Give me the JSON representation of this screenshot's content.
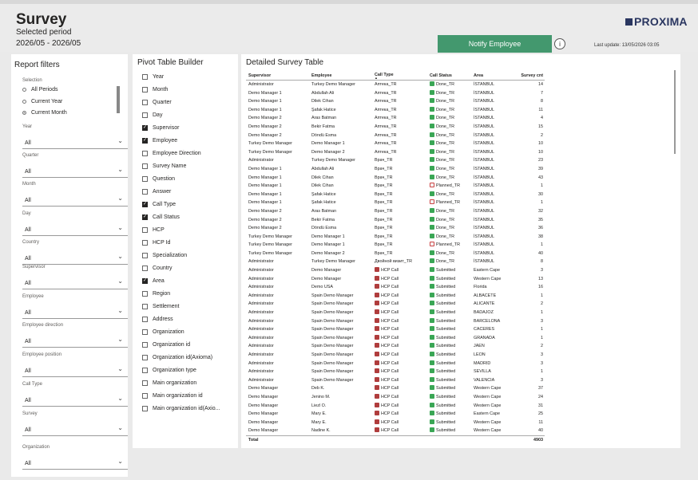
{
  "header": {
    "title": "Survey",
    "subtitle": "Selected period",
    "period": "2026/05 - 2026/05",
    "logo": "PROXIMA",
    "notify_label": "Notify Employee",
    "info_icon": "i",
    "last_update": "Last update: 13/05/2026 03:05"
  },
  "filters": {
    "title": "Report filters",
    "selection_label": "Selection",
    "radios": [
      {
        "label": "All Periods",
        "checked": false
      },
      {
        "label": "Current Year",
        "checked": false
      },
      {
        "label": "Current Month",
        "checked": true
      }
    ],
    "dropdowns": [
      {
        "label": "Year",
        "value": "All"
      },
      {
        "label": "Quarter",
        "value": "All"
      },
      {
        "label": "Month",
        "value": "All"
      },
      {
        "label": "Day",
        "value": "All"
      },
      {
        "label": "Country",
        "value": "All"
      },
      {
        "label": "Supervisor",
        "value": "All"
      },
      {
        "label": "Employee",
        "value": "All"
      },
      {
        "label": "Employee direction",
        "value": "All"
      },
      {
        "label": "Employee position",
        "value": "All"
      },
      {
        "label": "Call Type",
        "value": "All"
      },
      {
        "label": "Survey",
        "value": "All"
      },
      {
        "label": "Organization",
        "value": "All"
      }
    ]
  },
  "pivot": {
    "title": "Pivot Table Builder",
    "items": [
      {
        "label": "Year",
        "checked": false
      },
      {
        "label": "Month",
        "checked": false
      },
      {
        "label": "Quarter",
        "checked": false
      },
      {
        "label": "Day",
        "checked": false
      },
      {
        "label": "Supervisor",
        "checked": true
      },
      {
        "label": "Employee",
        "checked": true
      },
      {
        "label": "Employee Direction",
        "checked": false
      },
      {
        "label": "Survey Name",
        "checked": false
      },
      {
        "label": "Question",
        "checked": false
      },
      {
        "label": "Answer",
        "checked": false
      },
      {
        "label": "Call Type",
        "checked": true
      },
      {
        "label": "Call Status",
        "checked": true
      },
      {
        "label": "HCP",
        "checked": false
      },
      {
        "label": "HCP Id",
        "checked": false
      },
      {
        "label": "Specialization",
        "checked": false
      },
      {
        "label": "Country",
        "checked": false
      },
      {
        "label": "Area",
        "checked": true
      },
      {
        "label": "Region",
        "checked": false
      },
      {
        "label": "Settlement",
        "checked": false
      },
      {
        "label": "Address",
        "checked": false
      },
      {
        "label": "Organization",
        "checked": false
      },
      {
        "label": "Organization id",
        "checked": false
      },
      {
        "label": "Organization id(Axioma)",
        "checked": false
      },
      {
        "label": "Organization type",
        "checked": false
      },
      {
        "label": "Main organization",
        "checked": false
      },
      {
        "label": "Main organization id",
        "checked": false
      },
      {
        "label": "Main organization id(Axio...",
        "checked": false
      }
    ]
  },
  "table": {
    "title": "Detailed Survey Table",
    "columns": [
      "Supervisor",
      "Employee",
      "Call Type",
      "Call Status",
      "Area",
      "Survey cnt"
    ],
    "rows": [
      [
        "Administrator",
        "Turkey Demo Manager",
        "Аптека_TR",
        "Done_TR",
        "İSTANBUL",
        "14"
      ],
      [
        "Demo Manager 1",
        "Abdullah Ali",
        "Аптека_TR",
        "Done_TR",
        "İSTANBUL",
        "7"
      ],
      [
        "Demo Manager 1",
        "Dilek  Cihan",
        "Аптека_TR",
        "Done_TR",
        "İSTANBUL",
        "8"
      ],
      [
        "Demo Manager 1",
        "Şafak Hatice",
        "Аптека_TR",
        "Done_TR",
        "İSTANBUL",
        "11"
      ],
      [
        "Demo Manager 2",
        "Aras Batman",
        "Аптека_TR",
        "Done_TR",
        "İSTANBUL",
        "4"
      ],
      [
        "Demo Manager 2",
        "Bekir Fatma",
        "Аптека_TR",
        "Done_TR",
        "İSTANBUL",
        "15"
      ],
      [
        "Demo Manager 2",
        "Döndü Esma",
        "Аптека_TR",
        "Done_TR",
        "İSTANBUL",
        "2"
      ],
      [
        "Turkey Demo Manager",
        "Demo Manager 1",
        "Аптека_TR",
        "Done_TR",
        "İSTANBUL",
        "10"
      ],
      [
        "Turkey Demo Manager",
        "Demo Manager 2",
        "Аптека_TR",
        "Done_TR",
        "İSTANBUL",
        "10"
      ],
      [
        "Administrator",
        "Turkey Demo Manager",
        "Врач_TR",
        "Done_TR",
        "İSTANBUL",
        "23"
      ],
      [
        "Demo Manager 1",
        "Abdullah Ali",
        "Врач_TR",
        "Done_TR",
        "İSTANBUL",
        "39"
      ],
      [
        "Demo Manager 1",
        "Dilek  Cihan",
        "Врач_TR",
        "Done_TR",
        "İSTANBUL",
        "43"
      ],
      [
        "Demo Manager 1",
        "Dilek  Cihan",
        "Врач_TR",
        "Planned_TR",
        "İSTANBUL",
        "1"
      ],
      [
        "Demo Manager 1",
        "Şafak Hatice",
        "Врач_TR",
        "Done_TR",
        "İSTANBUL",
        "30"
      ],
      [
        "Demo Manager 1",
        "Şafak Hatice",
        "Врач_TR",
        "Planned_TR",
        "İSTANBUL",
        "1"
      ],
      [
        "Demo Manager 2",
        "Aras Batman",
        "Врач_TR",
        "Done_TR",
        "İSTANBUL",
        "32"
      ],
      [
        "Demo Manager 2",
        "Bekir Fatma",
        "Врач_TR",
        "Done_TR",
        "İSTANBUL",
        "35"
      ],
      [
        "Demo Manager 2",
        "Döndü Esma",
        "Врач_TR",
        "Done_TR",
        "İSTANBUL",
        "36"
      ],
      [
        "Turkey Demo Manager",
        "Demo Manager 1",
        "Врач_TR",
        "Done_TR",
        "İSTANBUL",
        "38"
      ],
      [
        "Turkey Demo Manager",
        "Demo Manager 1",
        "Врач_TR",
        "Planned_TR",
        "İSTANBUL",
        "1"
      ],
      [
        "Turkey Demo Manager",
        "Demo Manager 2",
        "Врач_TR",
        "Done_TR",
        "İSTANBUL",
        "40"
      ],
      [
        "Administrator",
        "Turkey Demo Manager",
        "Двойной визит_TR",
        "Done_TR",
        "İSTANBUL",
        "8"
      ],
      [
        "Administrator",
        "Demo Manager",
        "HCP Call",
        "Submitted",
        "Eastern Cape",
        "3"
      ],
      [
        "Administrator",
        "Demo Manager",
        "HCP Call",
        "Submitted",
        "Western Cape",
        "13"
      ],
      [
        "Administrator",
        "Demo USA",
        "HCP Call",
        "Submitted",
        "Florida",
        "16"
      ],
      [
        "Administrator",
        "Spain Demo Manager",
        "HCP Call",
        "Submitted",
        "ALBACETE",
        "1"
      ],
      [
        "Administrator",
        "Spain Demo Manager",
        "HCP Call",
        "Submitted",
        "ALICANTE",
        "2"
      ],
      [
        "Administrator",
        "Spain Demo Manager",
        "HCP Call",
        "Submitted",
        "BADAJOZ",
        "1"
      ],
      [
        "Administrator",
        "Spain Demo Manager",
        "HCP Call",
        "Submitted",
        "BARCELONA",
        "3"
      ],
      [
        "Administrator",
        "Spain Demo Manager",
        "HCP Call",
        "Submitted",
        "CACERES",
        "1"
      ],
      [
        "Administrator",
        "Spain Demo Manager",
        "HCP Call",
        "Submitted",
        "GRANADA",
        "1"
      ],
      [
        "Administrator",
        "Spain Demo Manager",
        "HCP Call",
        "Submitted",
        "JAEN",
        "2"
      ],
      [
        "Administrator",
        "Spain Demo Manager",
        "HCP Call",
        "Submitted",
        "LEON",
        "3"
      ],
      [
        "Administrator",
        "Spain Demo Manager",
        "HCP Call",
        "Submitted",
        "MADRID",
        "3"
      ],
      [
        "Administrator",
        "Spain Demo Manager",
        "HCP Call",
        "Submitted",
        "SEVILLA",
        "1"
      ],
      [
        "Administrator",
        "Spain Demo Manager",
        "HCP Call",
        "Submitted",
        "VALENCIA",
        "3"
      ],
      [
        "Demo Manager",
        "Deb K.",
        "HCP Call",
        "Submitted",
        "Western Cape",
        "37"
      ],
      [
        "Demo Manager",
        "Jenino M.",
        "HCP Call",
        "Submitted",
        "Western Cape",
        "24"
      ],
      [
        "Demo Manager",
        "Liezl O.",
        "HCP Call",
        "Submitted",
        "Western Cape",
        "31"
      ],
      [
        "Demo Manager",
        "Mary E.",
        "HCP Call",
        "Submitted",
        "Eastern Cape",
        "25"
      ],
      [
        "Demo Manager",
        "Mary E.",
        "HCP Call",
        "Submitted",
        "Western Cape",
        "11"
      ],
      [
        "Demo Manager",
        "Nadine K.",
        "HCP Call",
        "Submitted",
        "Western Cape",
        "40"
      ]
    ],
    "total_label": "Total",
    "total_value": "4903"
  },
  "colors": {
    "notify_button": "#43986e",
    "done_icon": "#3aa655",
    "logo": "#2a3660"
  }
}
